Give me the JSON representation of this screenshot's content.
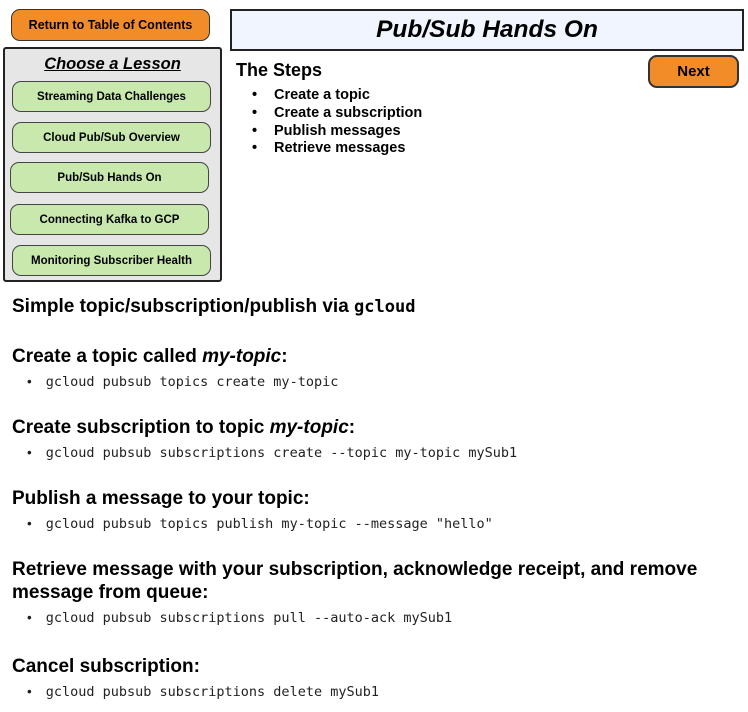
{
  "nav": {
    "toc_label": "Return to Table of Contents",
    "next_label": "Next"
  },
  "title": "Pub/Sub Hands On",
  "lessons": {
    "heading": "Choose a Lesson",
    "items": [
      "Streaming Data Challenges",
      "Cloud Pub/Sub Overview",
      "Pub/Sub Hands On",
      "Connecting Kafka to GCP",
      "Monitoring Subscriber Health"
    ]
  },
  "steps": {
    "title": "The Steps",
    "items": [
      "Create a topic",
      "Create a subscription",
      "Publish messages",
      "Retrieve messages"
    ]
  },
  "content": {
    "intro_prefix": "Simple topic/subscription/publish via ",
    "intro_code": "gcloud",
    "sections": [
      {
        "heading_a": "Create a topic called ",
        "heading_em": "my-topic",
        "heading_b": ":",
        "command": "gcloud pubsub topics create my-topic"
      },
      {
        "heading_a": "Create subscription to topic ",
        "heading_em": "my-topic",
        "heading_b": ":",
        "command": "gcloud pubsub subscriptions create --topic my-topic mySub1"
      },
      {
        "heading": "Publish a message to your topic:",
        "command": "gcloud pubsub topics publish my-topic --message \"hello\""
      },
      {
        "heading_line1": "Retrieve message with your subscription, acknowledge receipt, and remove",
        "heading_line2": "message from queue:",
        "command": "gcloud pubsub subscriptions pull --auto-ack mySub1"
      },
      {
        "heading": "Cancel subscription:",
        "command": "gcloud pubsub subscriptions delete mySub1"
      }
    ]
  }
}
